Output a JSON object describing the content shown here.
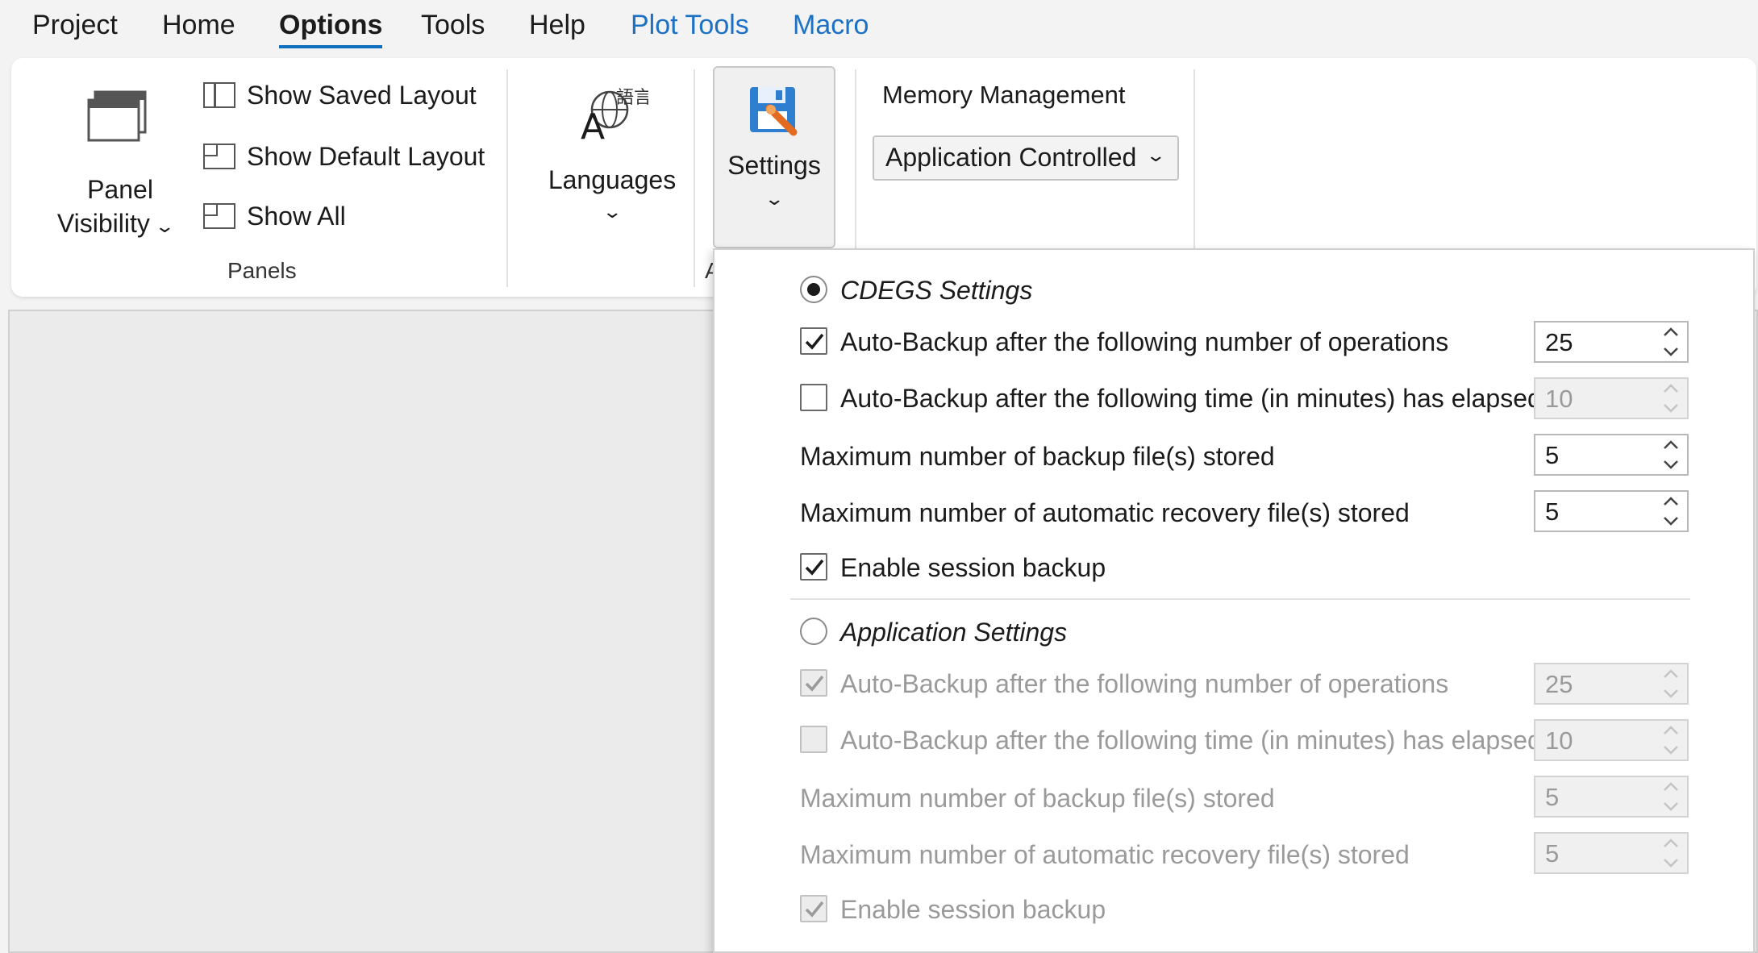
{
  "menu": {
    "project": "Project",
    "home": "Home",
    "options": "Options",
    "tools": "Tools",
    "help": "Help",
    "plot_tools": "Plot Tools",
    "macro": "Macro"
  },
  "ribbon": {
    "panel_visibility_line1": "Panel",
    "panel_visibility_line2": "Visibility",
    "show_saved_layout": "Show Saved Layout",
    "show_default_layout": "Show Default Layout",
    "show_all": "Show All",
    "panels_group": "Panels",
    "languages": "Languages",
    "settings": "Settings",
    "truncated_group_label": "A",
    "memory_management": "Memory Management",
    "memory_mode": "Application Controlled"
  },
  "flyout": {
    "cdegs": {
      "title": "CDEGS Settings",
      "selected": true,
      "auto_backup_ops_label": "Auto-Backup after the following number of operations",
      "auto_backup_ops_checked": true,
      "auto_backup_ops_value": "25",
      "auto_backup_time_label": "Auto-Backup after the following time (in minutes) has elapsed",
      "auto_backup_time_checked": false,
      "auto_backup_time_value": "10",
      "max_backup_label": "Maximum number of backup file(s) stored",
      "max_backup_value": "5",
      "max_recovery_label": "Maximum number of automatic recovery file(s) stored",
      "max_recovery_value": "5",
      "session_backup_label": "Enable session backup",
      "session_backup_checked": true
    },
    "application": {
      "title": "Application Settings",
      "selected": false,
      "auto_backup_ops_label": "Auto-Backup after the following number of operations",
      "auto_backup_ops_checked": true,
      "auto_backup_ops_value": "25",
      "auto_backup_time_label": "Auto-Backup after the following time (in minutes) has elapsed",
      "auto_backup_time_checked": false,
      "auto_backup_time_value": "10",
      "max_backup_label": "Maximum number of backup file(s) stored",
      "max_backup_value": "5",
      "max_recovery_label": "Maximum number of automatic recovery file(s) stored",
      "max_recovery_value": "5",
      "session_backup_label": "Enable session backup",
      "session_backup_checked": true
    }
  },
  "colors": {
    "accent": "#0c6ebd",
    "contextual_tab": "#1d71c4",
    "disabled_text": "#9a9a9a"
  }
}
